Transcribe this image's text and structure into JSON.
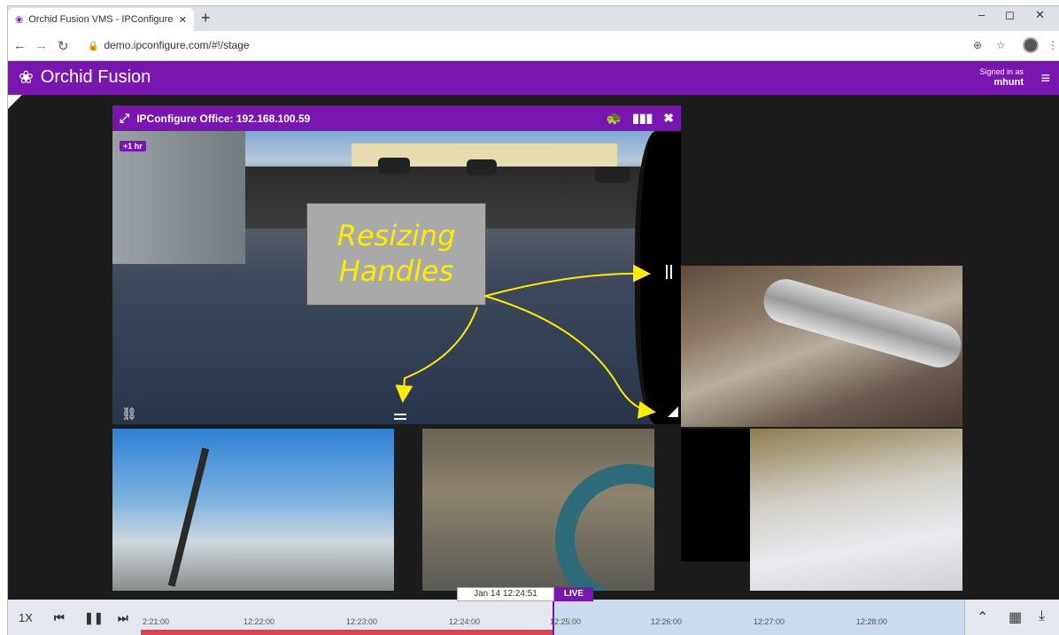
{
  "browser": {
    "tab_title": "Orchid Fusion VMS - IPConfigure",
    "tab_close": "✕",
    "new_tab": "+",
    "url": "demo.ipconfigure.com/#!/stage",
    "minimize": "–",
    "restore": "◻",
    "close": "✕"
  },
  "app": {
    "title": "Orchid Fusion",
    "signed_in_label": "Signed in as",
    "username": "mhunt"
  },
  "main_tile": {
    "camera_name": "IPConfigure Office: 192.168.100.59",
    "time_offset_badge": "+1 hr"
  },
  "annotation": {
    "line1": "Resizing",
    "line2": "Handles"
  },
  "timeline": {
    "speed": "1X",
    "current_time": "Jan 14 12:24:51",
    "live_label": "LIVE",
    "ticks": [
      "2:21:00",
      "12:22:00",
      "12:23:00",
      "12:24:00",
      "12:25:00",
      "12:26:00",
      "12:27:00",
      "12:28:00"
    ]
  },
  "icons": {
    "tile_expand": "expand-arrows-icon",
    "tile_speed": "turtle-icon",
    "tile_stats": "bar-chart-icon",
    "tile_close": "close-icon"
  },
  "colors": {
    "brand": "#7a16b0",
    "annotation_text": "#ffeb00",
    "recorded_strip": "#e04050"
  }
}
